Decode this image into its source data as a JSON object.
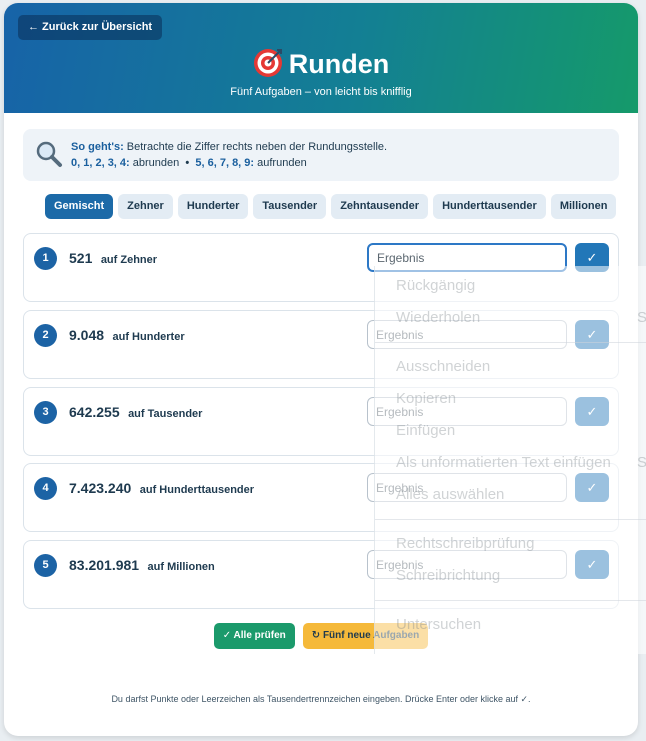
{
  "header": {
    "back_label": "← Zurück zur Übersicht",
    "title": "Runden",
    "subtitle": "Fünf Aufgaben – von leicht bis knifflig"
  },
  "hint": {
    "lead": "So geht's:",
    "text": "Betrachte die Ziffer rechts neben der Rundungsstelle.",
    "down_digits": "0, 1, 2, 3, 4:",
    "down_text": "abrunden",
    "bullet": "•",
    "up_digits": "5, 6, 7, 8, 9:",
    "up_text": "aufrunden"
  },
  "tabs": [
    {
      "label": "Gemischt"
    },
    {
      "label": "Zehner"
    },
    {
      "label": "Hunderter"
    },
    {
      "label": "Tausender"
    },
    {
      "label": "Zehntausender"
    },
    {
      "label": "Hunderttausender"
    },
    {
      "label": "Millionen"
    }
  ],
  "active_tab": "Gemischt",
  "tasks": [
    {
      "index": "1",
      "number": "521",
      "unit": "auf Zehner",
      "placeholder": "Ergebnis",
      "check": "✓"
    },
    {
      "index": "2",
      "number": "9.048",
      "unit": "auf Hunderter",
      "placeholder": "Ergebnis",
      "check": "✓"
    },
    {
      "index": "3",
      "number": "642.255",
      "unit": "auf Tausender",
      "placeholder": "Ergebnis",
      "check": "✓"
    },
    {
      "index": "4",
      "number": "7.423.240",
      "unit": "auf Hunderttausender",
      "placeholder": "Ergebnis",
      "check": "✓"
    },
    {
      "index": "5",
      "number": "83.201.981",
      "unit": "auf Millionen",
      "placeholder": "Ergebnis",
      "check": "✓"
    }
  ],
  "actions": {
    "check_all": "✓ Alle prüfen",
    "new_tasks": "↻ Fünf neue Aufgaben"
  },
  "footer": "Du darfst Punkte oder Leerzeichen als Tausendertrennzeichen eingeben. Drücke Enter oder klicke auf ✓.",
  "context_menu": {
    "items": [
      "Rückgängig",
      "Wiederholen",
      "Ausschneiden",
      "Kopieren",
      "Einfügen",
      "Als unformatierten Text einfügen",
      "Alles auswählen",
      "Rechtschreibprüfung",
      "Schreibrichtung",
      "Untersuchen"
    ],
    "shortcut_redo": "St",
    "shortcut_paste_plain": "St"
  },
  "colors": {
    "header_start": "#1763a8",
    "header_end": "#159a6a",
    "accent_blue": "#1c6aa8",
    "check_green": "#1b9a6b",
    "new_yellow": "#f5b93a"
  }
}
